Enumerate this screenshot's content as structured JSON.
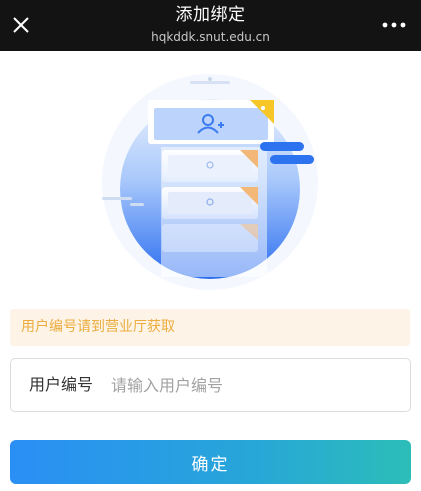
{
  "header": {
    "title": "添加绑定",
    "domain": "hqkddk.snut.edu.cn",
    "close_icon": "close-icon",
    "more_icon": "more-dots-icon"
  },
  "hero": {
    "icon": "add-user-illustration",
    "colors": {
      "primary": "#3b7bf2",
      "accent_yellow": "#f5c518",
      "accent_orange": "#f0a24b"
    }
  },
  "notice": {
    "text": "用户编号请到营业厅获取"
  },
  "form": {
    "user_id_label": "用户编号",
    "user_id_value": "",
    "user_id_placeholder": "请输入用户编号"
  },
  "actions": {
    "confirm_label": "确定"
  },
  "colors": {
    "topbar_bg": "#131313",
    "notice_bg": "#fdf3e6",
    "notice_text": "#ebad3f",
    "button_gradient_start": "#2a8ff5",
    "button_gradient_end": "#2cbdb8"
  }
}
